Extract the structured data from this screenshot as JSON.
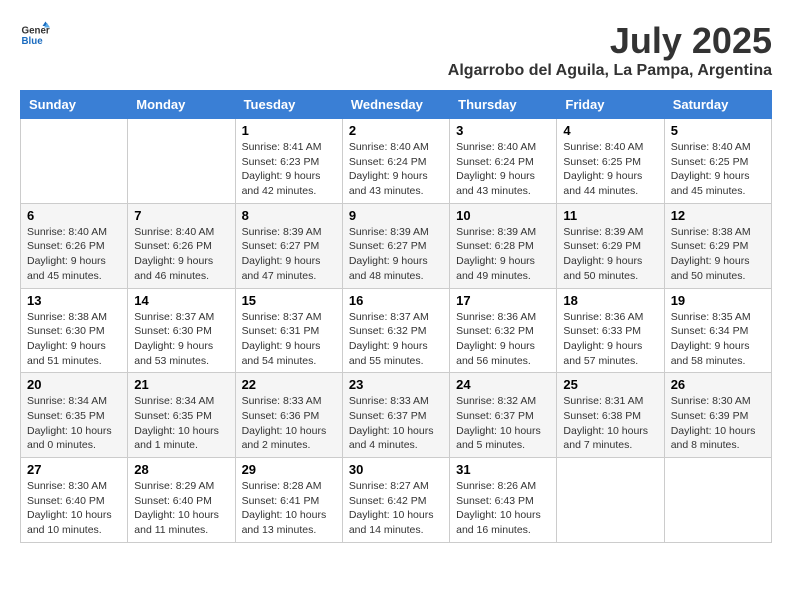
{
  "header": {
    "logo_line1": "General",
    "logo_line2": "Blue",
    "main_title": "July 2025",
    "subtitle": "Algarrobo del Aguila, La Pampa, Argentina"
  },
  "calendar": {
    "days_of_week": [
      "Sunday",
      "Monday",
      "Tuesday",
      "Wednesday",
      "Thursday",
      "Friday",
      "Saturday"
    ],
    "weeks": [
      [
        {
          "day": "",
          "sunrise": "",
          "sunset": "",
          "daylight": ""
        },
        {
          "day": "",
          "sunrise": "",
          "sunset": "",
          "daylight": ""
        },
        {
          "day": "1",
          "sunrise": "Sunrise: 8:41 AM",
          "sunset": "Sunset: 6:23 PM",
          "daylight": "Daylight: 9 hours and 42 minutes."
        },
        {
          "day": "2",
          "sunrise": "Sunrise: 8:40 AM",
          "sunset": "Sunset: 6:24 PM",
          "daylight": "Daylight: 9 hours and 43 minutes."
        },
        {
          "day": "3",
          "sunrise": "Sunrise: 8:40 AM",
          "sunset": "Sunset: 6:24 PM",
          "daylight": "Daylight: 9 hours and 43 minutes."
        },
        {
          "day": "4",
          "sunrise": "Sunrise: 8:40 AM",
          "sunset": "Sunset: 6:25 PM",
          "daylight": "Daylight: 9 hours and 44 minutes."
        },
        {
          "day": "5",
          "sunrise": "Sunrise: 8:40 AM",
          "sunset": "Sunset: 6:25 PM",
          "daylight": "Daylight: 9 hours and 45 minutes."
        }
      ],
      [
        {
          "day": "6",
          "sunrise": "Sunrise: 8:40 AM",
          "sunset": "Sunset: 6:26 PM",
          "daylight": "Daylight: 9 hours and 45 minutes."
        },
        {
          "day": "7",
          "sunrise": "Sunrise: 8:40 AM",
          "sunset": "Sunset: 6:26 PM",
          "daylight": "Daylight: 9 hours and 46 minutes."
        },
        {
          "day": "8",
          "sunrise": "Sunrise: 8:39 AM",
          "sunset": "Sunset: 6:27 PM",
          "daylight": "Daylight: 9 hours and 47 minutes."
        },
        {
          "day": "9",
          "sunrise": "Sunrise: 8:39 AM",
          "sunset": "Sunset: 6:27 PM",
          "daylight": "Daylight: 9 hours and 48 minutes."
        },
        {
          "day": "10",
          "sunrise": "Sunrise: 8:39 AM",
          "sunset": "Sunset: 6:28 PM",
          "daylight": "Daylight: 9 hours and 49 minutes."
        },
        {
          "day": "11",
          "sunrise": "Sunrise: 8:39 AM",
          "sunset": "Sunset: 6:29 PM",
          "daylight": "Daylight: 9 hours and 50 minutes."
        },
        {
          "day": "12",
          "sunrise": "Sunrise: 8:38 AM",
          "sunset": "Sunset: 6:29 PM",
          "daylight": "Daylight: 9 hours and 50 minutes."
        }
      ],
      [
        {
          "day": "13",
          "sunrise": "Sunrise: 8:38 AM",
          "sunset": "Sunset: 6:30 PM",
          "daylight": "Daylight: 9 hours and 51 minutes."
        },
        {
          "day": "14",
          "sunrise": "Sunrise: 8:37 AM",
          "sunset": "Sunset: 6:30 PM",
          "daylight": "Daylight: 9 hours and 53 minutes."
        },
        {
          "day": "15",
          "sunrise": "Sunrise: 8:37 AM",
          "sunset": "Sunset: 6:31 PM",
          "daylight": "Daylight: 9 hours and 54 minutes."
        },
        {
          "day": "16",
          "sunrise": "Sunrise: 8:37 AM",
          "sunset": "Sunset: 6:32 PM",
          "daylight": "Daylight: 9 hours and 55 minutes."
        },
        {
          "day": "17",
          "sunrise": "Sunrise: 8:36 AM",
          "sunset": "Sunset: 6:32 PM",
          "daylight": "Daylight: 9 hours and 56 minutes."
        },
        {
          "day": "18",
          "sunrise": "Sunrise: 8:36 AM",
          "sunset": "Sunset: 6:33 PM",
          "daylight": "Daylight: 9 hours and 57 minutes."
        },
        {
          "day": "19",
          "sunrise": "Sunrise: 8:35 AM",
          "sunset": "Sunset: 6:34 PM",
          "daylight": "Daylight: 9 hours and 58 minutes."
        }
      ],
      [
        {
          "day": "20",
          "sunrise": "Sunrise: 8:34 AM",
          "sunset": "Sunset: 6:35 PM",
          "daylight": "Daylight: 10 hours and 0 minutes."
        },
        {
          "day": "21",
          "sunrise": "Sunrise: 8:34 AM",
          "sunset": "Sunset: 6:35 PM",
          "daylight": "Daylight: 10 hours and 1 minute."
        },
        {
          "day": "22",
          "sunrise": "Sunrise: 8:33 AM",
          "sunset": "Sunset: 6:36 PM",
          "daylight": "Daylight: 10 hours and 2 minutes."
        },
        {
          "day": "23",
          "sunrise": "Sunrise: 8:33 AM",
          "sunset": "Sunset: 6:37 PM",
          "daylight": "Daylight: 10 hours and 4 minutes."
        },
        {
          "day": "24",
          "sunrise": "Sunrise: 8:32 AM",
          "sunset": "Sunset: 6:37 PM",
          "daylight": "Daylight: 10 hours and 5 minutes."
        },
        {
          "day": "25",
          "sunrise": "Sunrise: 8:31 AM",
          "sunset": "Sunset: 6:38 PM",
          "daylight": "Daylight: 10 hours and 7 minutes."
        },
        {
          "day": "26",
          "sunrise": "Sunrise: 8:30 AM",
          "sunset": "Sunset: 6:39 PM",
          "daylight": "Daylight: 10 hours and 8 minutes."
        }
      ],
      [
        {
          "day": "27",
          "sunrise": "Sunrise: 8:30 AM",
          "sunset": "Sunset: 6:40 PM",
          "daylight": "Daylight: 10 hours and 10 minutes."
        },
        {
          "day": "28",
          "sunrise": "Sunrise: 8:29 AM",
          "sunset": "Sunset: 6:40 PM",
          "daylight": "Daylight: 10 hours and 11 minutes."
        },
        {
          "day": "29",
          "sunrise": "Sunrise: 8:28 AM",
          "sunset": "Sunset: 6:41 PM",
          "daylight": "Daylight: 10 hours and 13 minutes."
        },
        {
          "day": "30",
          "sunrise": "Sunrise: 8:27 AM",
          "sunset": "Sunset: 6:42 PM",
          "daylight": "Daylight: 10 hours and 14 minutes."
        },
        {
          "day": "31",
          "sunrise": "Sunrise: 8:26 AM",
          "sunset": "Sunset: 6:43 PM",
          "daylight": "Daylight: 10 hours and 16 minutes."
        },
        {
          "day": "",
          "sunrise": "",
          "sunset": "",
          "daylight": ""
        },
        {
          "day": "",
          "sunrise": "",
          "sunset": "",
          "daylight": ""
        }
      ]
    ]
  }
}
